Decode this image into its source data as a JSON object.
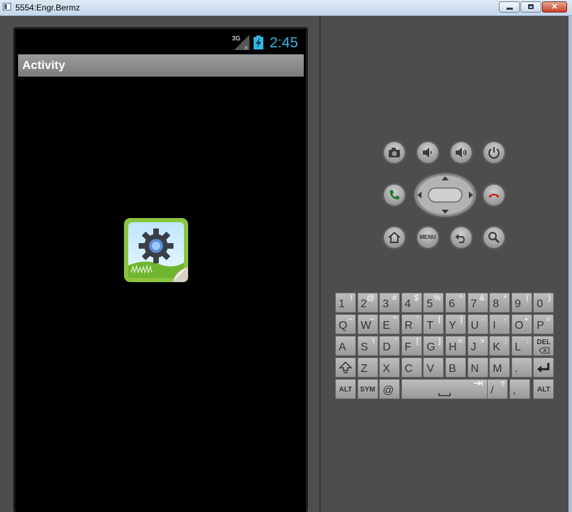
{
  "window": {
    "title": "5554:Engr.Bermz"
  },
  "device": {
    "status_bar": {
      "network": "3G",
      "time": "2:45"
    },
    "action_bar": {
      "title": "Activity"
    }
  },
  "keyboard": {
    "row1": [
      {
        "main": "1",
        "alt": "!"
      },
      {
        "main": "2",
        "alt": "@"
      },
      {
        "main": "3",
        "alt": "#"
      },
      {
        "main": "4",
        "alt": "$"
      },
      {
        "main": "5",
        "alt": "%"
      },
      {
        "main": "6",
        "alt": "^"
      },
      {
        "main": "7",
        "alt": "&"
      },
      {
        "main": "8",
        "alt": "*"
      },
      {
        "main": "9",
        "alt": "("
      },
      {
        "main": "0",
        "alt": ")"
      }
    ],
    "row2": [
      {
        "main": "Q",
        "alt": "~"
      },
      {
        "main": "W",
        "alt": "~"
      },
      {
        "main": "E",
        "alt": "\""
      },
      {
        "main": "R",
        "alt": "`"
      },
      {
        "main": "T",
        "alt": "{"
      },
      {
        "main": "Y",
        "alt": "}"
      },
      {
        "main": "U",
        "alt": "-"
      },
      {
        "main": "I",
        "alt": "-"
      },
      {
        "main": "O",
        "alt": "+"
      },
      {
        "main": "P",
        "alt": "="
      }
    ],
    "row3": [
      {
        "main": "A",
        "alt": ""
      },
      {
        "main": "S",
        "alt": "\\"
      },
      {
        "main": "D",
        "alt": "'"
      },
      {
        "main": "F",
        "alt": "["
      },
      {
        "main": "G",
        "alt": "]"
      },
      {
        "main": "H",
        "alt": "<"
      },
      {
        "main": "J",
        "alt": ">"
      },
      {
        "main": "K",
        "alt": ";"
      },
      {
        "main": "L",
        "alt": ":"
      },
      {
        "main": "DEL",
        "alt": ""
      }
    ],
    "row4": [
      {
        "main": "",
        "alt": ""
      },
      {
        "main": "Z",
        "alt": ""
      },
      {
        "main": "X",
        "alt": ""
      },
      {
        "main": "C",
        "alt": ""
      },
      {
        "main": "V",
        "alt": ""
      },
      {
        "main": "B",
        "alt": ""
      },
      {
        "main": "N",
        "alt": ""
      },
      {
        "main": "M",
        "alt": ""
      },
      {
        "main": ".",
        "alt": ""
      },
      {
        "main": "",
        "alt": ""
      }
    ],
    "row5": {
      "alt_left": "ALT",
      "sym": "SYM",
      "at": "@",
      "slash": "/",
      "slash_alt": "?",
      "comma": ",",
      "alt_right": "ALT"
    }
  },
  "controls": {
    "menu_label": "MENU"
  },
  "icons": {
    "camera": "camera-icon",
    "volume_down": "volume-down-icon",
    "volume_up": "volume-up-icon",
    "power": "power-icon",
    "call": "call-icon",
    "end_call": "end-call-icon",
    "home": "home-icon",
    "back": "back-icon",
    "search": "search-icon",
    "app": "settings-gear-icon"
  },
  "colors": {
    "clock": "#33b5e5",
    "call_green": "#1f7a2b",
    "end_red": "#c8231d"
  }
}
